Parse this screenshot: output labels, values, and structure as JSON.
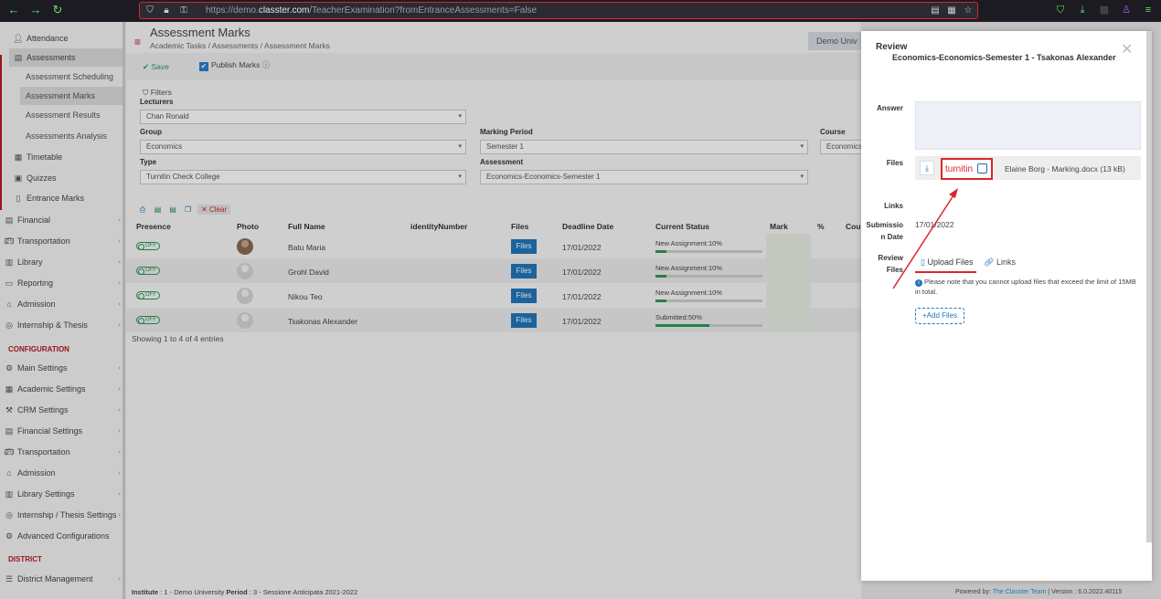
{
  "browser": {
    "url_prefix": "https://demo.",
    "url_domain": "classter.com",
    "url_path": "/TeacherExamination?fromEntranceAssessments=False"
  },
  "sidebar": {
    "items": [
      {
        "label": "Attendance",
        "icon": "user-icon"
      },
      {
        "label": "Assessments",
        "icon": "assessment-icon"
      },
      {
        "label": "Assessment Scheduling"
      },
      {
        "label": "Assessment Marks"
      },
      {
        "label": "Assessment Results"
      },
      {
        "label": "Assessments Analysis"
      },
      {
        "label": "Timetable",
        "icon": "calendar-icon"
      },
      {
        "label": "Quizzes",
        "icon": "quiz-icon"
      },
      {
        "label": "Entrance Marks",
        "icon": "entrance-icon"
      },
      {
        "label": "Financial",
        "icon": "financial-icon"
      },
      {
        "label": "Transportation",
        "icon": "bus-icon"
      },
      {
        "label": "Library",
        "icon": "library-icon"
      },
      {
        "label": "Reporting",
        "icon": "reporting-icon"
      },
      {
        "label": "Admission",
        "icon": "admission-icon"
      },
      {
        "label": "Internship & Thesis",
        "icon": "internship-icon"
      }
    ],
    "config_heading": "CONFIGURATION",
    "config_items": [
      {
        "label": "Main Settings"
      },
      {
        "label": "Academic Settings"
      },
      {
        "label": "CRM Settings"
      },
      {
        "label": "Financial Settings"
      },
      {
        "label": "Transportation"
      },
      {
        "label": "Admission"
      },
      {
        "label": "Library Settings"
      },
      {
        "label": "Internship / Thesis Settings"
      },
      {
        "label": "Advanced Configurations"
      }
    ],
    "district_heading": "DISTRICT",
    "district_items": [
      {
        "label": "District Management"
      }
    ]
  },
  "main": {
    "title": "Assessment Marks",
    "breadcrumb": "Academic Tasks  /  Assessments  /  Assessment Marks",
    "demo_button": "Demo Univ",
    "save_label": "Save",
    "publish_label": "Publish Marks",
    "filters_label": "Filters",
    "filters": {
      "lecturers_label": "Lecturers",
      "lecturers_value": "Chan Ronald",
      "group_label": "Group",
      "group_value": "Economics",
      "marking_period_label": "Marking Period",
      "marking_period_value": "Semester 1",
      "course_label": "Course",
      "course_value": "Economics",
      "type_label": "Type",
      "type_value": "Turnitin Check College",
      "assessment_label": "Assessment",
      "assessment_value": "Economics-Economics-Semester 1"
    },
    "clear_label": "Clear",
    "columns": [
      "Presence",
      "Photo",
      "Full Name",
      "identityNumber",
      "Files",
      "Deadline Date",
      "Current Status",
      "Mark",
      "%",
      "Cou"
    ],
    "rows": [
      {
        "presence": "OFF",
        "name": "Batu Maria",
        "files": "Files",
        "deadline": "17/01/2022",
        "status": "New Assignment:10%",
        "progress": 0.1
      },
      {
        "presence": "OFF",
        "name": "Grohl David",
        "files": "Files",
        "deadline": "17/01/2022",
        "status": "New Assignment:10%",
        "progress": 0.1
      },
      {
        "presence": "OFF",
        "name": "Nikou Teo",
        "files": "Files",
        "deadline": "17/01/2022",
        "status": "New Assignment:10%",
        "progress": 0.1
      },
      {
        "presence": "OFF",
        "name": "Tsakonas Alexander",
        "files": "Files",
        "deadline": "17/01/2022",
        "status": "Submitted:50%",
        "progress": 0.5
      }
    ],
    "showing": "Showing 1 to 4 of 4 entries",
    "footer_institute_label": "Institute",
    "footer_institute": " : 1 - Demo University ",
    "footer_period_label": "Period",
    "footer_period": " : 3 - Sessione Anticipata 2021-2022"
  },
  "modal": {
    "title": "Review",
    "subtitle": "Economics-Economics-Semester 1 - Tsakonas Alexander",
    "answer_label": "Answer",
    "files_label": "Files",
    "turnitin_label": "turnitin",
    "file_name": "Elaine Borg - Marking.docx (13 kB)",
    "links_label": "Links",
    "submission_label_1": "Submissio",
    "submission_label_2": "n Date",
    "submission_date": "17/01/2022",
    "review_label_1": "Review",
    "review_label_2": "Files",
    "tab_upload": "Upload Files",
    "tab_links": "Links",
    "note": "Please note that you cannot upload files that exceed the limit of 15MB in total.",
    "add_files": "Add Files"
  },
  "footer": {
    "powered_prefix": "Powered by: ",
    "powered_team": "The Classter Team",
    "version": " | Version : 6.0.2022.40115"
  },
  "colors": {
    "accent_red": "#b11d23",
    "primary_blue": "#2277bb",
    "success_green": "#2a9a5b",
    "annotation_red": "#d9262c"
  }
}
